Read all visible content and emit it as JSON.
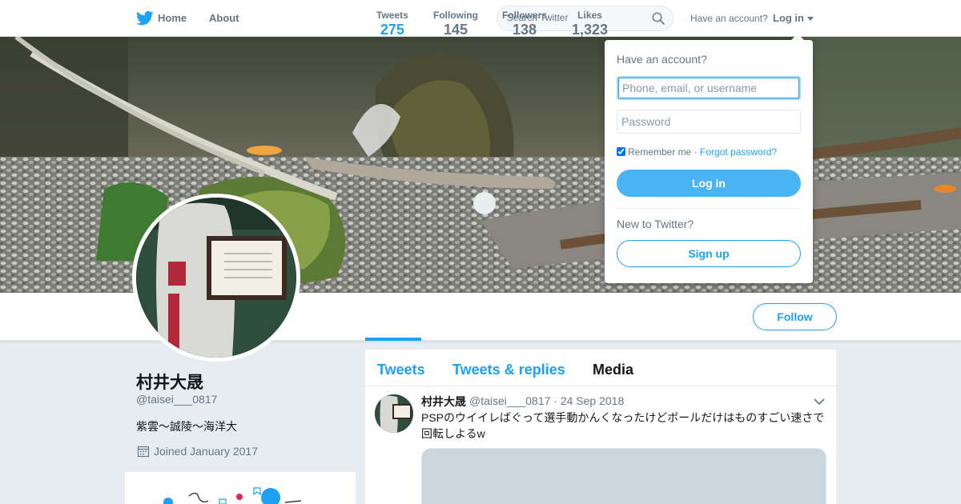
{
  "nav": {
    "home_label": "Home",
    "about_label": "About",
    "search_placeholder": "Search Twitter",
    "have_account": "Have an account?",
    "login_label": "Log in",
    "logo_icon": "twitter-bird-icon",
    "brand_color": "#1da1f2"
  },
  "profile": {
    "name": "村井大晟",
    "handle": "@taisei___0817",
    "bio": "紫雲～誠陵～海洋大",
    "joined": "Joined January 2017",
    "follow_label": "Follow"
  },
  "stats": [
    {
      "label": "Tweets",
      "value": "275",
      "active": true
    },
    {
      "label": "Following",
      "value": "145",
      "active": false
    },
    {
      "label": "Followers",
      "value": "138",
      "active": false
    },
    {
      "label": "Likes",
      "value": "1,323",
      "active": false
    }
  ],
  "timeline": {
    "tabs": [
      {
        "label": "Tweets"
      },
      {
        "label": "Tweets & replies"
      },
      {
        "label": "Media"
      }
    ],
    "tweet": {
      "name": "村井大晟",
      "meta": "@taisei___0817 · 24 Sep 2018",
      "text": "PSPのウイイレばぐって選手動かんくなったけどボールだけはものすごい速さで回転しよるw"
    }
  },
  "login_dropdown": {
    "title": "Have an account?",
    "username_placeholder": "Phone, email, or username",
    "password_placeholder": "Password",
    "remember_label": "Remember me",
    "separator": " · ",
    "forgot_label": "Forgot password?",
    "login_button": "Log in",
    "new_label": "New to Twitter?",
    "signup_button": "Sign up"
  }
}
